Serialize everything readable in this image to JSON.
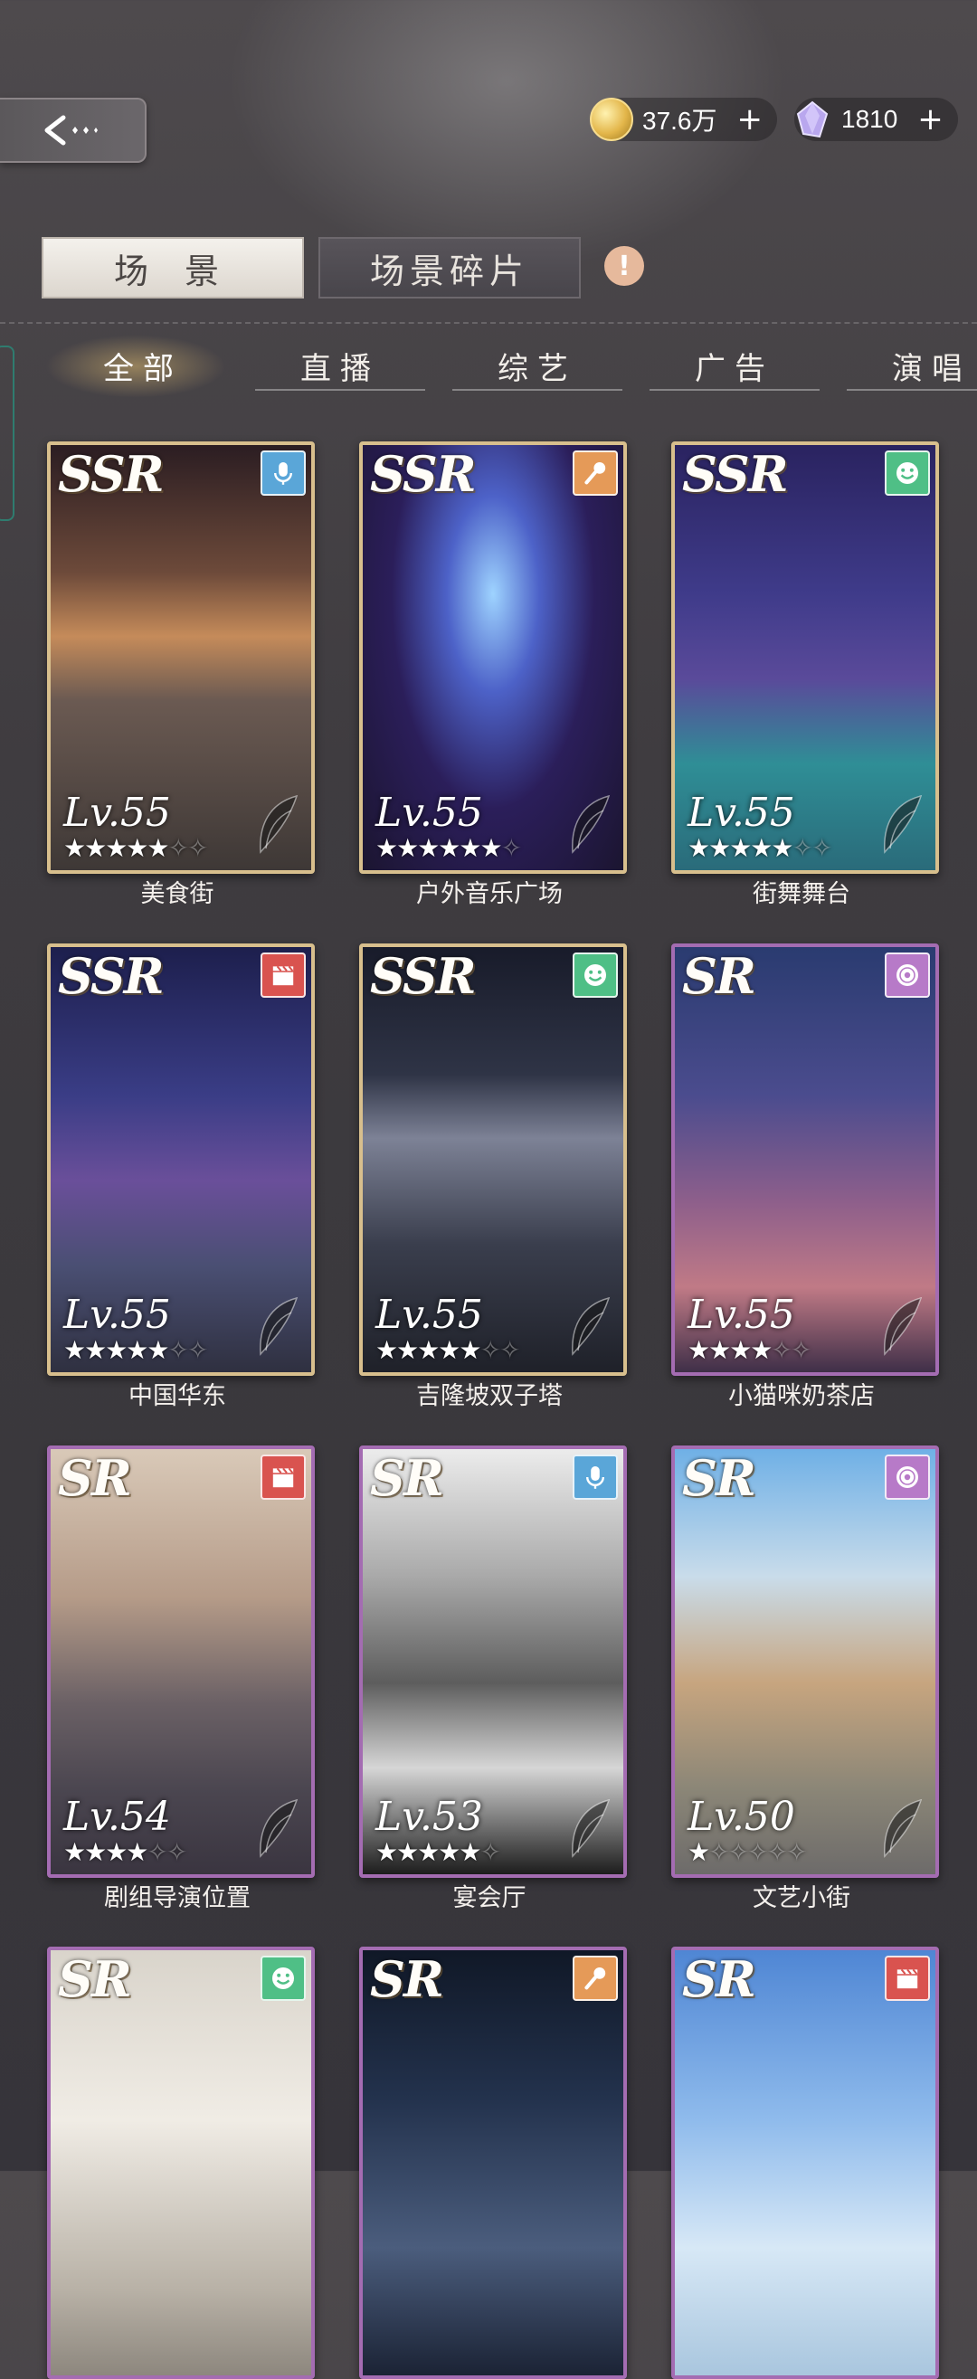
{
  "header": {
    "currencies": [
      {
        "icon": "gold-coin-icon",
        "value": "37.6万"
      },
      {
        "icon": "diamond-gem-icon",
        "value": "1810"
      }
    ],
    "plus_label": "+"
  },
  "tabs": {
    "scene": "场 景",
    "fragments": "场景碎片",
    "alert_glyph": "!"
  },
  "categories": [
    "全部",
    "直播",
    "综艺",
    "广告",
    "演唱"
  ],
  "cards": [
    {
      "rarity": "SSR",
      "level": "Lv.55",
      "stars": 5,
      "max_stars": 7,
      "name": "美食街",
      "type_icon": "microphone-icon",
      "type_color": "#5aa6d8",
      "art": "food-street"
    },
    {
      "rarity": "SSR",
      "level": "Lv.55",
      "stars": 6,
      "max_stars": 7,
      "name": "户外音乐广场",
      "type_icon": "handheld-mic-icon",
      "type_color": "#e59a58",
      "art": "music-plaza"
    },
    {
      "rarity": "SSR",
      "level": "Lv.55",
      "stars": 5,
      "max_stars": 7,
      "name": "街舞舞台",
      "type_icon": "smiley-icon",
      "type_color": "#4fbf86",
      "art": "dance-stage"
    },
    {
      "rarity": "SSR",
      "level": "Lv.55",
      "stars": 5,
      "max_stars": 7,
      "name": "中国华东",
      "type_icon": "clapperboard-icon",
      "type_color": "#d9534f",
      "art": "city-night"
    },
    {
      "rarity": "SSR",
      "level": "Lv.55",
      "stars": 5,
      "max_stars": 7,
      "name": "吉隆坡双子塔",
      "type_icon": "smiley-icon",
      "type_color": "#4fbf86",
      "art": "twin-towers"
    },
    {
      "rarity": "SR",
      "level": "Lv.55",
      "stars": 4,
      "max_stars": 6,
      "name": "小猫咪奶茶店",
      "type_icon": "record-icon",
      "type_color": "#b77ac8",
      "art": "milk-tea"
    },
    {
      "rarity": "SR",
      "level": "Lv.54",
      "stars": 4,
      "max_stars": 6,
      "name": "剧组导演位置",
      "type_icon": "clapperboard-icon",
      "type_color": "#d9534f",
      "art": "film-set"
    },
    {
      "rarity": "SR",
      "level": "Lv.53",
      "stars": 5,
      "max_stars": 6,
      "name": "宴会厅",
      "type_icon": "microphone-icon",
      "type_color": "#5aa6d8",
      "art": "banquet"
    },
    {
      "rarity": "SR",
      "level": "Lv.50",
      "stars": 1,
      "max_stars": 6,
      "name": "文艺小街",
      "type_icon": "record-icon",
      "type_color": "#b77ac8",
      "art": "art-street"
    },
    {
      "rarity": "SR",
      "level": "",
      "stars": 0,
      "max_stars": 0,
      "name": "",
      "type_icon": "smiley-icon",
      "type_color": "#4fbf86",
      "art": "white-hall"
    },
    {
      "rarity": "SR",
      "level": "",
      "stars": 0,
      "max_stars": 0,
      "name": "",
      "type_icon": "handheld-mic-icon",
      "type_color": "#e59a58",
      "art": "arena"
    },
    {
      "rarity": "SR",
      "level": "",
      "stars": 0,
      "max_stars": 0,
      "name": "",
      "type_icon": "clapperboard-icon",
      "type_color": "#d9534f",
      "art": "sky"
    }
  ]
}
